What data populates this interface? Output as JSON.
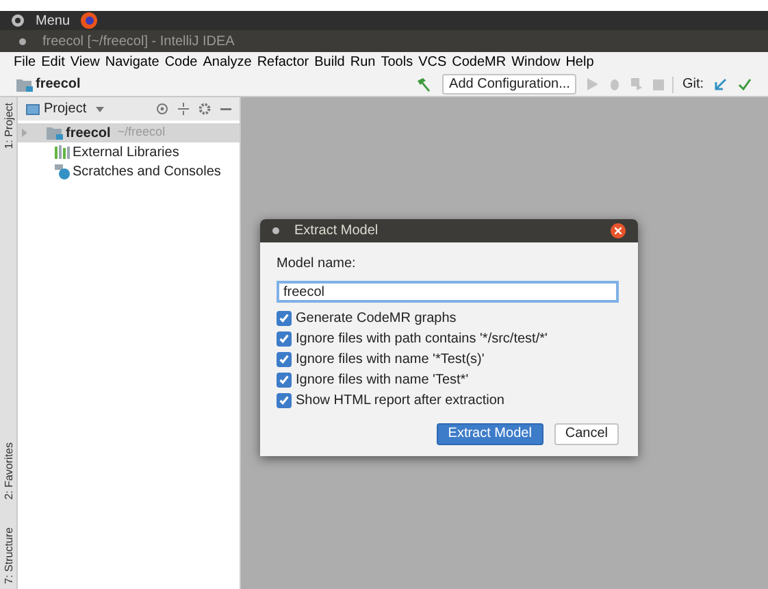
{
  "desktop_bar": {
    "menu": "Menu"
  },
  "window": {
    "title": "freecol [~/freecol] - IntelliJ IDEA"
  },
  "menu_bar": [
    "File",
    "Edit",
    "View",
    "Navigate",
    "Code",
    "Analyze",
    "Refactor",
    "Build",
    "Run",
    "Tools",
    "VCS",
    "CodeMR",
    "Window",
    "Help"
  ],
  "toolbar": {
    "project": "freecol",
    "run_config": "Add Configuration...",
    "git_label": "Git:"
  },
  "tool_stripe": {
    "top": [
      "1: Project"
    ],
    "bottom": [
      "2: Favorites",
      "7: Structure"
    ]
  },
  "project_panel": {
    "title": "Project",
    "tree": [
      {
        "label": "freecol",
        "hint": "~/freecol",
        "kind": "module",
        "selected": true
      },
      {
        "label": "External Libraries",
        "kind": "libraries",
        "selected": false
      },
      {
        "label": "Scratches and Consoles",
        "kind": "scratches",
        "selected": false
      }
    ]
  },
  "dialog": {
    "title": "Extract Model",
    "field_label": "Model name:",
    "field_value": "freecol",
    "options": [
      {
        "label": "Generate CodeMR graphs",
        "checked": true
      },
      {
        "label": "Ignore files with path contains '*/src/test/*'",
        "checked": true
      },
      {
        "label": "Ignore files with name '*Test(s)'",
        "checked": true
      },
      {
        "label": "Ignore files with name 'Test*'",
        "checked": true
      },
      {
        "label": "Show HTML report after extraction",
        "checked": true
      }
    ],
    "buttons": [
      "Extract Model",
      "Cancel"
    ]
  }
}
